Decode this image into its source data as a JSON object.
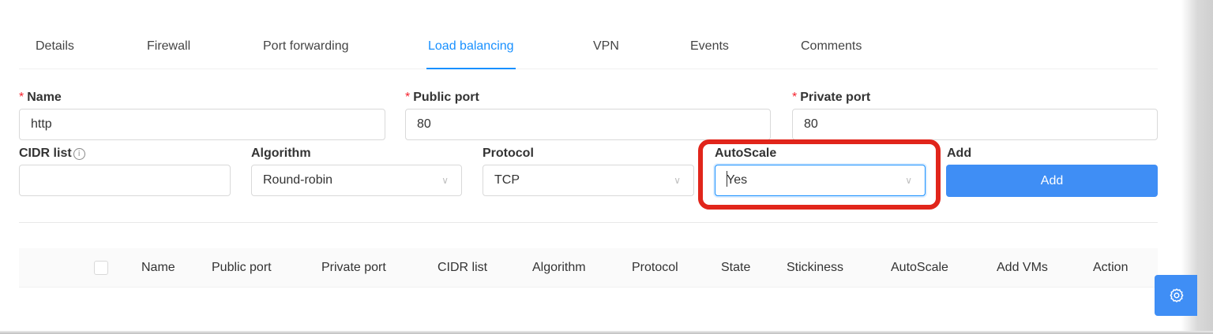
{
  "tabs": [
    {
      "label": "Details",
      "active": false
    },
    {
      "label": "Firewall",
      "active": false
    },
    {
      "label": "Port forwarding",
      "active": false
    },
    {
      "label": "Load balancing",
      "active": true
    },
    {
      "label": "VPN",
      "active": false
    },
    {
      "label": "Events",
      "active": false
    },
    {
      "label": "Comments",
      "active": false
    }
  ],
  "form": {
    "required_mark": "*",
    "name": {
      "label": "Name",
      "value": "http"
    },
    "public_port": {
      "label": "Public port",
      "value": "80"
    },
    "private_port": {
      "label": "Private port",
      "value": "80"
    },
    "cidr_list": {
      "label": "CIDR list",
      "value": ""
    },
    "algorithm": {
      "label": "Algorithm",
      "value": "Round-robin"
    },
    "protocol": {
      "label": "Protocol",
      "value": "TCP"
    },
    "autoscale": {
      "label": "AutoScale",
      "value": "Yes"
    },
    "add": {
      "label": "Add",
      "button_label": "Add"
    }
  },
  "icons": {
    "info": "info-circle-icon",
    "chevron": "chevron-down-icon",
    "settings": "gear-icon"
  },
  "colors": {
    "accent": "#1890ff",
    "button": "#3f8ef5",
    "required": "#f5222d",
    "highlight": "#e1251b"
  },
  "table": {
    "columns": [
      "Name",
      "Public port",
      "Private port",
      "CIDR list",
      "Algorithm",
      "Protocol",
      "State",
      "Stickiness",
      "AutoScale",
      "Add VMs",
      "Action"
    ],
    "rows": []
  }
}
